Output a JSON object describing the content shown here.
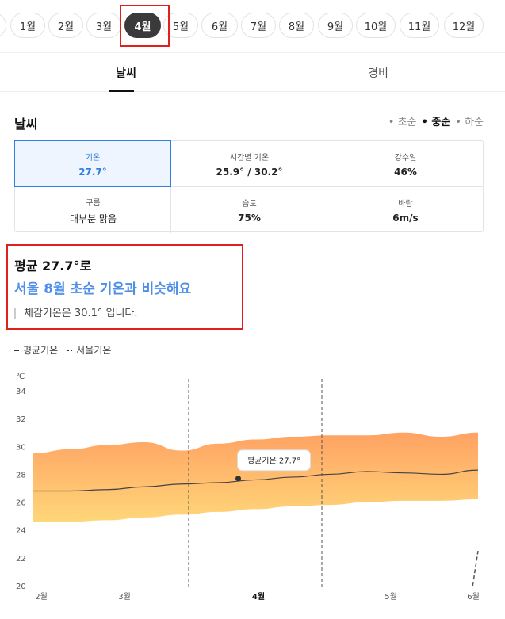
{
  "months": [
    "1월",
    "2월",
    "3월",
    "4월",
    "5월",
    "6월",
    "7월",
    "8월",
    "9월",
    "10월",
    "11월",
    "12월"
  ],
  "selected_month": "4월",
  "tabs": [
    {
      "label": "날씨"
    },
    {
      "label": "경비"
    }
  ],
  "weather": {
    "title": "날씨",
    "periods": [
      {
        "label": "• 초순",
        "on": false
      },
      {
        "label": "• 중순",
        "on": true
      },
      {
        "label": "• 하순",
        "on": false
      }
    ],
    "stats": [
      {
        "key": "기온",
        "value": "27.7°"
      },
      {
        "key": "시간별 기온",
        "value": "25.9° / 30.2°"
      },
      {
        "key": "강수일",
        "value": "46%"
      },
      {
        "key": "구름",
        "value": "대부분 맑음"
      },
      {
        "key": "습도",
        "value": "75%"
      },
      {
        "key": "바람",
        "value": "6m/s"
      }
    ]
  },
  "summary": {
    "line1": "평균 27.7°로",
    "line2": "서울 8월 초순 기온과 비슷해요",
    "line3": "체감기온은 30.1° 입니다."
  },
  "legend": {
    "avg": "평균기온",
    "seoul": "서울기온"
  },
  "colors": {
    "accent": "#2f7fe0",
    "band_top": "#ff9a55",
    "band_bottom": "#ffd36e",
    "highlight": "#e0201b"
  },
  "chart_data": {
    "type": "area",
    "ylabel": "℃",
    "yticks": [
      34,
      32,
      30,
      28,
      26,
      24,
      22,
      20
    ],
    "ylim": [
      20,
      34
    ],
    "x_labels": [
      "2월",
      "3월",
      "4월",
      "5월",
      "6월"
    ],
    "bold_x_label": "4월",
    "x": [
      0,
      1,
      2,
      3,
      4,
      5,
      6,
      7,
      8,
      9,
      10,
      11,
      12
    ],
    "series": [
      {
        "name": "평균기온",
        "values": [
          26.8,
          26.8,
          26.9,
          27.1,
          27.3,
          27.4,
          27.6,
          27.8,
          28.0,
          28.2,
          28.1,
          28.0,
          28.3
        ]
      },
      {
        "role": "high",
        "values": [
          29.5,
          29.8,
          30.1,
          30.3,
          29.7,
          30.2,
          30.5,
          30.7,
          30.8,
          30.8,
          31.0,
          30.7,
          31.0
        ]
      },
      {
        "role": "low",
        "values": [
          24.6,
          24.6,
          24.7,
          24.9,
          25.1,
          25.3,
          25.5,
          25.7,
          25.8,
          26.0,
          26.1,
          26.1,
          26.2
        ]
      },
      {
        "name": "서울기온",
        "values": [
          null,
          null,
          null,
          null,
          null,
          null,
          null,
          null,
          null,
          null,
          null,
          20.0,
          22.5
        ]
      }
    ],
    "tooltip": {
      "label": "평균기온 27.7°",
      "x": 6,
      "y": 27.7
    }
  }
}
